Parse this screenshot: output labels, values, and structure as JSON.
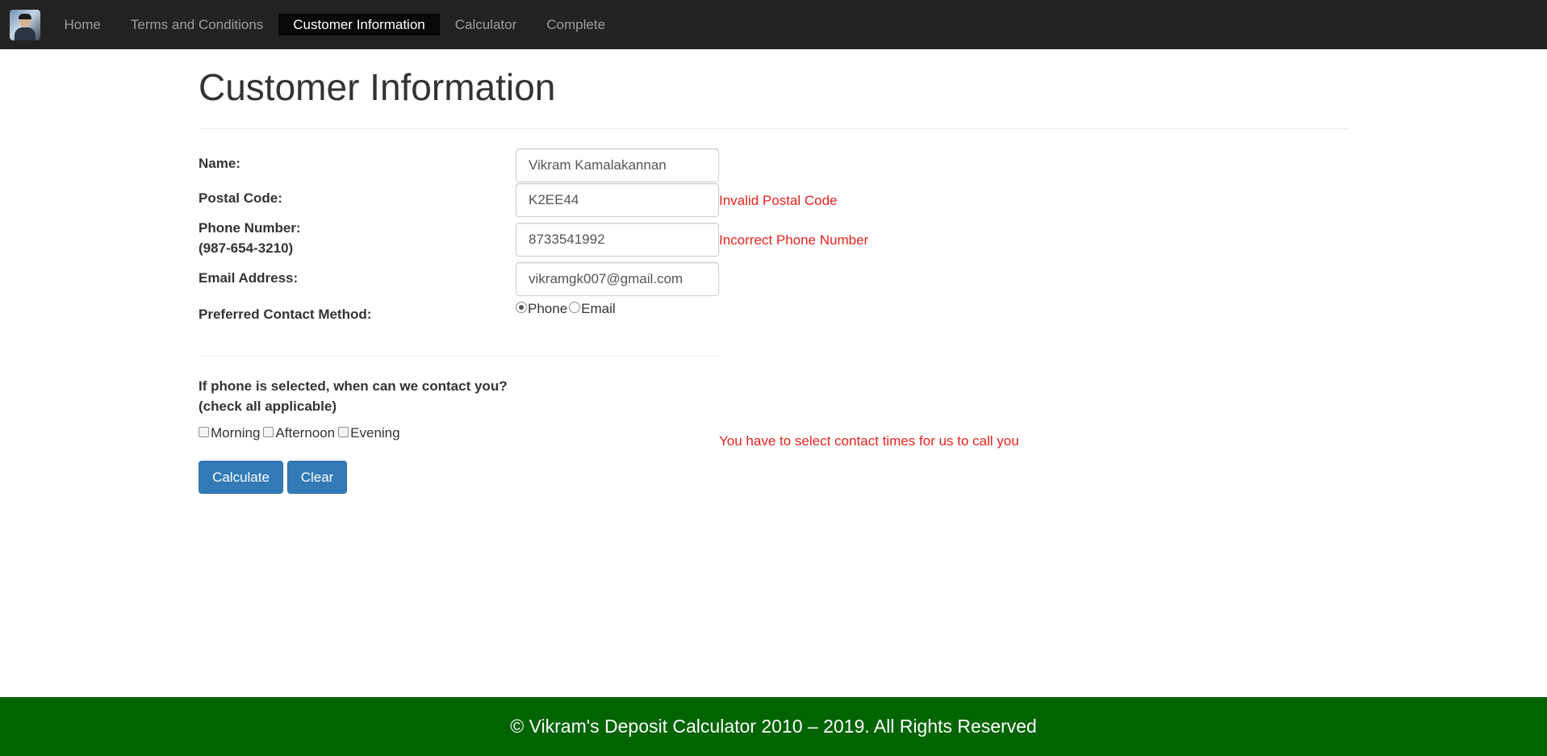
{
  "nav": {
    "logo": "user-photo-logo",
    "items": [
      {
        "label": "Home",
        "active": false
      },
      {
        "label": "Terms and Conditions",
        "active": false
      },
      {
        "label": "Customer Information",
        "active": true
      },
      {
        "label": "Calculator",
        "active": false
      },
      {
        "label": "Complete",
        "active": false
      }
    ]
  },
  "page": {
    "title": "Customer Information"
  },
  "form": {
    "name": {
      "label": "Name:",
      "value": "Vikram Kamalakannan"
    },
    "postal": {
      "label": "Postal Code:",
      "value": "K2EE44",
      "error": "Invalid Postal Code"
    },
    "phone": {
      "label": "Phone Number:",
      "hint": "(987-654-3210)",
      "value": "8733541992",
      "error": "Incorrect Phone Number"
    },
    "email": {
      "label": "Email Address:",
      "value": "vikramgk007@gmail.com"
    },
    "contact_method": {
      "label": "Preferred Contact Method:",
      "options": [
        {
          "label": "Phone",
          "checked": true
        },
        {
          "label": "Email",
          "checked": false
        }
      ]
    },
    "contact_times": {
      "question": "If phone is selected, when can we contact you?",
      "hint": "(check all applicable)",
      "options": [
        {
          "label": "Morning",
          "checked": false
        },
        {
          "label": "Afternoon",
          "checked": false
        },
        {
          "label": "Evening",
          "checked": false
        }
      ],
      "error": "You have to select contact times for us to call you"
    },
    "buttons": {
      "calculate": "Calculate",
      "clear": "Clear"
    }
  },
  "footer": {
    "text": "© Vikram's Deposit Calculator 2010 – 2019. All Rights Reserved"
  },
  "colors": {
    "navbar": "#222222",
    "active_tab": "#080808",
    "error": "#e8241f",
    "primary_button": "#337ab7",
    "footer": "#006400"
  }
}
